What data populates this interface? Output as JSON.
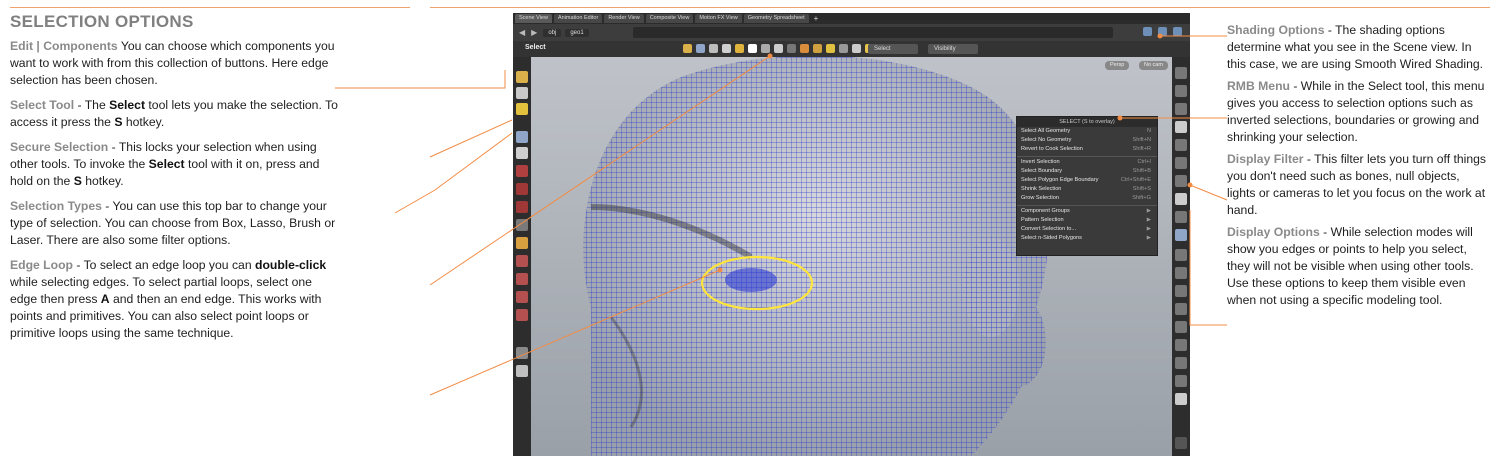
{
  "left_column": {
    "title": "SELECTION OPTIONS",
    "paragraphs": [
      {
        "head": "Edit | Components",
        "pre": " You can choose which components you want to work with from this collection of buttons. Here edge selection has been chosen.",
        "b1": "",
        "mid": "",
        "b2": "",
        "post": ""
      },
      {
        "head": "Select Tool",
        "pre": " - The ",
        "b1": "Select",
        "mid": " tool lets you make the selection. To access it press the ",
        "b2": "S",
        "post": " hotkey."
      },
      {
        "head": "Secure Selection",
        "pre": " - This locks your selection when using other tools. To invoke the ",
        "b1": "Select",
        "mid": " tool with it on, press and hold on the ",
        "b2": "S",
        "post": " hotkey."
      },
      {
        "head": "Selection Types",
        "pre": " - You can use this top bar to change your type of selection. You can choose from Box, Lasso, Brush or Laser. There are also some filter options.",
        "b1": "",
        "mid": "",
        "b2": "",
        "post": ""
      },
      {
        "head": "Edge Loop",
        "pre": " - To select an edge loop you can ",
        "b1": "double-click",
        "mid": " while selecting edges. To select partial loops, select one edge then press ",
        "b2": "A",
        "post": " and then an end edge. This works with points and primitives. You can also select point loops or primitive loops using the same technique."
      }
    ]
  },
  "right_column": {
    "paragraphs": [
      {
        "head": "Shading Options",
        "text": " - The shading options determine what you see in the Scene view. In this case, we are using Smooth Wired Shading."
      },
      {
        "head": "RMB Menu",
        "text": " - While in the Select tool, this menu gives you access to selection options such as inverted selections, boundaries or growing and shrinking your selection."
      },
      {
        "head": "Display Filter",
        "text": " - This filter lets you turn off things you don't need such as bones, null objects, lights or cameras to let you focus on the work at hand."
      },
      {
        "head": "Display Options",
        "text": " - While selection modes will show you edges or points to help you select, they will not be visible when using other tools. Use these options to keep them visible even when not using a specific modeling tool."
      }
    ]
  },
  "app": {
    "tabs": [
      "Scene View",
      "Animation Editor",
      "Render View",
      "Composite View",
      "Motion FX View",
      "Geometry Spreadsheet"
    ],
    "tab_plus": "+",
    "path": [
      "obj",
      "geo1"
    ],
    "tool_label": "Select",
    "select_dropdown": "Select",
    "visibility_dropdown": "Visibility",
    "viewport_buttons": [
      "Persp",
      "No cam"
    ],
    "rmb_menu": {
      "title": "SELECT (S to overlay)",
      "items": [
        {
          "label": "Select All Geometry",
          "hotkey": "N"
        },
        {
          "label": "Select No Geometry",
          "hotkey": "Shift+N"
        },
        {
          "label": "Revert to Cook Selection",
          "hotkey": "Shift+R"
        },
        {
          "label": "Invert Selection",
          "hotkey": "Ctrl+I"
        },
        {
          "label": "Select Boundary",
          "hotkey": "Shift+B"
        },
        {
          "label": "Select Polygon Edge Boundary",
          "hotkey": "Ctrl+Shift+E"
        },
        {
          "label": "Shrink Selection",
          "hotkey": "Shift+S"
        },
        {
          "label": "Grow Selection",
          "hotkey": "Shift+G"
        },
        {
          "label": "Component Groups",
          "hotkey": "▶"
        },
        {
          "label": "Pattern Selection",
          "hotkey": "▶"
        },
        {
          "label": "Convert Selection to...",
          "hotkey": "▶"
        },
        {
          "label": "Select n-Sided Polygons",
          "hotkey": "▶"
        }
      ]
    }
  },
  "colors": {
    "accent": "#f28c45",
    "mesh": "#1f2fd6",
    "highlight": "#ffe53a"
  }
}
